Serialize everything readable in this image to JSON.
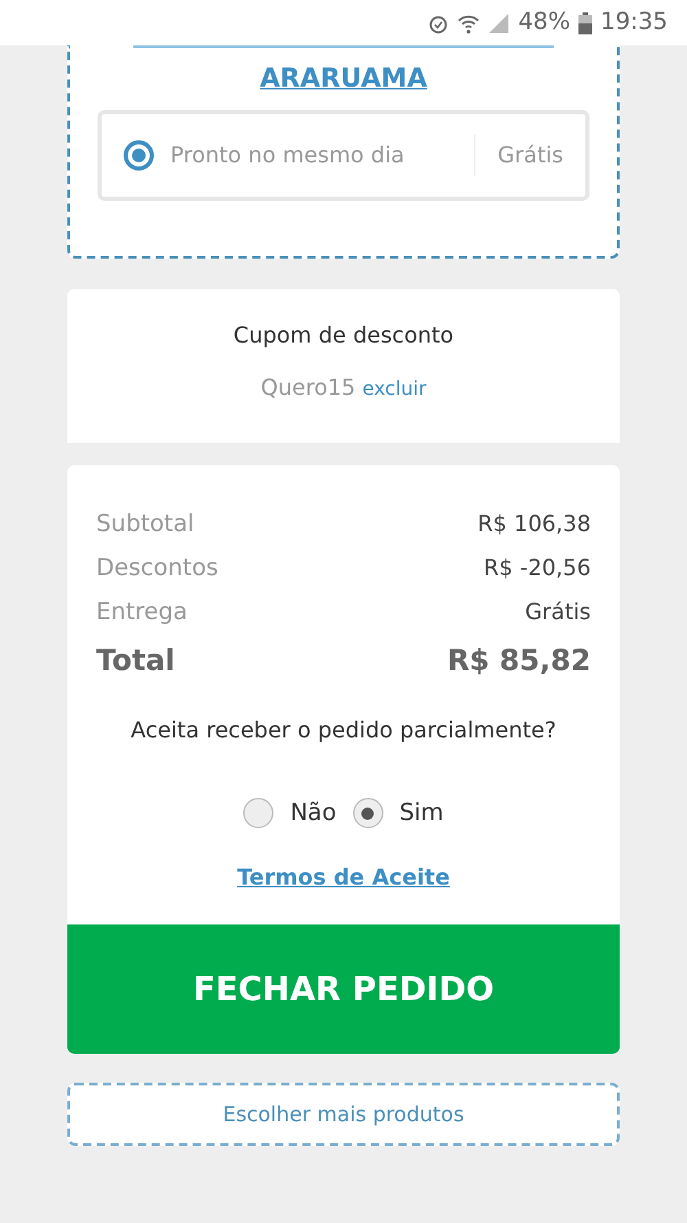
{
  "status_bar": {
    "battery": "48%",
    "time": "19:35"
  },
  "store": {
    "name": "ARARUAMA",
    "options": [
      {
        "label": "Pronto no mesmo dia",
        "price": "Grátis",
        "selected": true
      }
    ]
  },
  "coupon": {
    "title": "Cupom de desconto",
    "code": "Quero15",
    "remove_link": "excluir"
  },
  "summary": {
    "rows": [
      {
        "label": "Subtotal",
        "value": "R$ 106,38",
        "kind": "line"
      },
      {
        "label": "Descontos",
        "value": "R$ -20,56",
        "kind": "line"
      },
      {
        "label": "Entrega",
        "value": "Grátis",
        "kind": "line"
      },
      {
        "label": "Total",
        "value": "R$ 85,82",
        "kind": "total"
      }
    ]
  },
  "partial": {
    "question": "Aceita receber o pedido parcialmente?",
    "options": [
      {
        "label": "Não",
        "selected": false
      },
      {
        "label": "Sim",
        "selected": true
      }
    ]
  },
  "terms_link": "Termos de Aceite",
  "checkout_button": "FECHAR PEDIDO",
  "more_products_button": "Escolher mais produtos"
}
